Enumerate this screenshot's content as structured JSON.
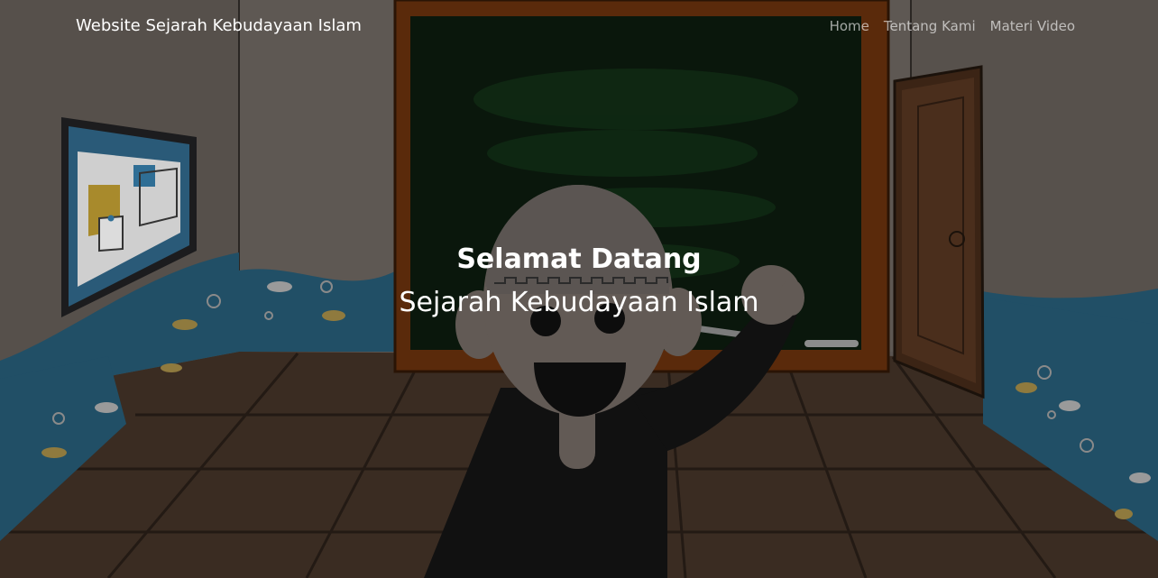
{
  "navbar": {
    "brand": "Website Sejarah Kebudayaan Islam",
    "links": [
      {
        "label": "Home"
      },
      {
        "label": "Tentang Kami"
      },
      {
        "label": "Materi Video"
      }
    ]
  },
  "hero": {
    "title": "Selamat Datang",
    "subtitle": "Sejarah Kebudayaan Islam"
  },
  "colors": {
    "wall": "#5b5550",
    "floor": "#3a2b20",
    "chalkboard": "#0a1a0d",
    "board_frame": "#5a2b0c",
    "wave": "#1f4e66",
    "text": "#ffffff"
  }
}
